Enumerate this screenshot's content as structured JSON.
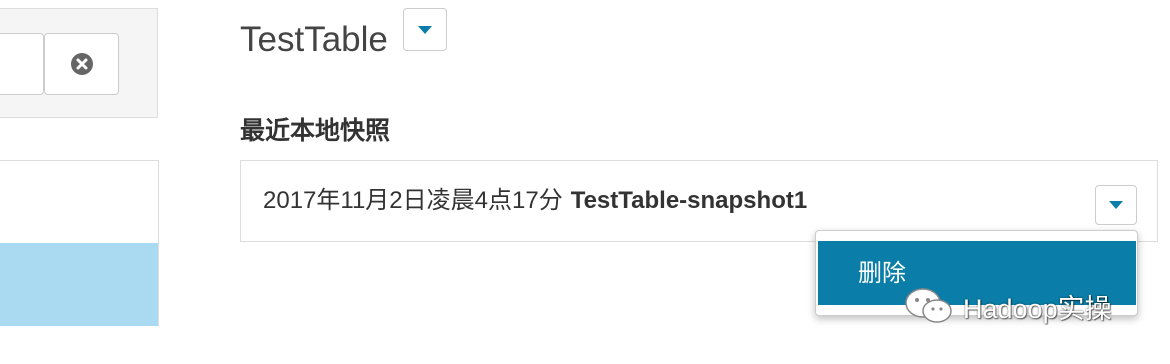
{
  "left_panel": {
    "clear_icon": "clear-circle-x-icon",
    "selected_color": "#a9daf2"
  },
  "header": {
    "title": "TestTable",
    "dropdown_icon": "caret-down-icon"
  },
  "snapshots": {
    "section_label": "最近本地快照",
    "item": {
      "date": "2017年11月2日凌晨4点17分",
      "name": "TestTable-snapshot1"
    },
    "dropdown_icon": "caret-down-icon"
  },
  "menu": {
    "items": [
      {
        "label": "删除",
        "highlight_color": "#0a7ea8"
      }
    ]
  },
  "watermark": {
    "text": "Hadoop实操",
    "icon": "wechat-icon"
  },
  "colors": {
    "accent": "#0a7ea8",
    "border": "#dddddd"
  }
}
